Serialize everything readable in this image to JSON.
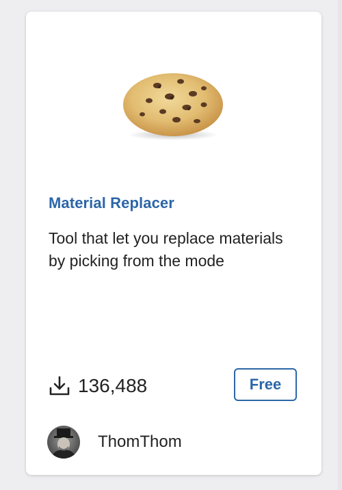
{
  "card": {
    "thumbnail_icon": "cookie-image",
    "title": "Material Replacer",
    "description": "Tool that let you replace materials by picking from the mode",
    "download_icon": "download-icon",
    "download_count": "136,488",
    "price_label": "Free",
    "author_name": "ThomThom",
    "author_avatar_icon": "avatar-photo"
  },
  "colors": {
    "accent": "#2b66a8",
    "text": "#222222",
    "background": "#eeeef1",
    "card": "#ffffff"
  }
}
